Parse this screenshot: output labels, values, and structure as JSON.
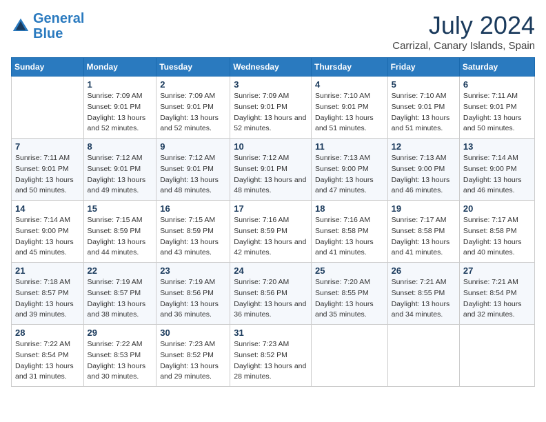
{
  "logo": {
    "text1": "General",
    "text2": "Blue"
  },
  "title": "July 2024",
  "location": "Carrizal, Canary Islands, Spain",
  "days_header": [
    "Sunday",
    "Monday",
    "Tuesday",
    "Wednesday",
    "Thursday",
    "Friday",
    "Saturday"
  ],
  "weeks": [
    {
      "cells": [
        {
          "day": null,
          "sunrise": null,
          "sunset": null,
          "daylight": null
        },
        {
          "day": "1",
          "sunrise": "Sunrise: 7:09 AM",
          "sunset": "Sunset: 9:01 PM",
          "daylight": "Daylight: 13 hours and 52 minutes."
        },
        {
          "day": "2",
          "sunrise": "Sunrise: 7:09 AM",
          "sunset": "Sunset: 9:01 PM",
          "daylight": "Daylight: 13 hours and 52 minutes."
        },
        {
          "day": "3",
          "sunrise": "Sunrise: 7:09 AM",
          "sunset": "Sunset: 9:01 PM",
          "daylight": "Daylight: 13 hours and 52 minutes."
        },
        {
          "day": "4",
          "sunrise": "Sunrise: 7:10 AM",
          "sunset": "Sunset: 9:01 PM",
          "daylight": "Daylight: 13 hours and 51 minutes."
        },
        {
          "day": "5",
          "sunrise": "Sunrise: 7:10 AM",
          "sunset": "Sunset: 9:01 PM",
          "daylight": "Daylight: 13 hours and 51 minutes."
        },
        {
          "day": "6",
          "sunrise": "Sunrise: 7:11 AM",
          "sunset": "Sunset: 9:01 PM",
          "daylight": "Daylight: 13 hours and 50 minutes."
        }
      ]
    },
    {
      "cells": [
        {
          "day": "7",
          "sunrise": "Sunrise: 7:11 AM",
          "sunset": "Sunset: 9:01 PM",
          "daylight": "Daylight: 13 hours and 50 minutes."
        },
        {
          "day": "8",
          "sunrise": "Sunrise: 7:12 AM",
          "sunset": "Sunset: 9:01 PM",
          "daylight": "Daylight: 13 hours and 49 minutes."
        },
        {
          "day": "9",
          "sunrise": "Sunrise: 7:12 AM",
          "sunset": "Sunset: 9:01 PM",
          "daylight": "Daylight: 13 hours and 48 minutes."
        },
        {
          "day": "10",
          "sunrise": "Sunrise: 7:12 AM",
          "sunset": "Sunset: 9:01 PM",
          "daylight": "Daylight: 13 hours and 48 minutes."
        },
        {
          "day": "11",
          "sunrise": "Sunrise: 7:13 AM",
          "sunset": "Sunset: 9:00 PM",
          "daylight": "Daylight: 13 hours and 47 minutes."
        },
        {
          "day": "12",
          "sunrise": "Sunrise: 7:13 AM",
          "sunset": "Sunset: 9:00 PM",
          "daylight": "Daylight: 13 hours and 46 minutes."
        },
        {
          "day": "13",
          "sunrise": "Sunrise: 7:14 AM",
          "sunset": "Sunset: 9:00 PM",
          "daylight": "Daylight: 13 hours and 46 minutes."
        }
      ]
    },
    {
      "cells": [
        {
          "day": "14",
          "sunrise": "Sunrise: 7:14 AM",
          "sunset": "Sunset: 9:00 PM",
          "daylight": "Daylight: 13 hours and 45 minutes."
        },
        {
          "day": "15",
          "sunrise": "Sunrise: 7:15 AM",
          "sunset": "Sunset: 8:59 PM",
          "daylight": "Daylight: 13 hours and 44 minutes."
        },
        {
          "day": "16",
          "sunrise": "Sunrise: 7:15 AM",
          "sunset": "Sunset: 8:59 PM",
          "daylight": "Daylight: 13 hours and 43 minutes."
        },
        {
          "day": "17",
          "sunrise": "Sunrise: 7:16 AM",
          "sunset": "Sunset: 8:59 PM",
          "daylight": "Daylight: 13 hours and 42 minutes."
        },
        {
          "day": "18",
          "sunrise": "Sunrise: 7:16 AM",
          "sunset": "Sunset: 8:58 PM",
          "daylight": "Daylight: 13 hours and 41 minutes."
        },
        {
          "day": "19",
          "sunrise": "Sunrise: 7:17 AM",
          "sunset": "Sunset: 8:58 PM",
          "daylight": "Daylight: 13 hours and 41 minutes."
        },
        {
          "day": "20",
          "sunrise": "Sunrise: 7:17 AM",
          "sunset": "Sunset: 8:58 PM",
          "daylight": "Daylight: 13 hours and 40 minutes."
        }
      ]
    },
    {
      "cells": [
        {
          "day": "21",
          "sunrise": "Sunrise: 7:18 AM",
          "sunset": "Sunset: 8:57 PM",
          "daylight": "Daylight: 13 hours and 39 minutes."
        },
        {
          "day": "22",
          "sunrise": "Sunrise: 7:19 AM",
          "sunset": "Sunset: 8:57 PM",
          "daylight": "Daylight: 13 hours and 38 minutes."
        },
        {
          "day": "23",
          "sunrise": "Sunrise: 7:19 AM",
          "sunset": "Sunset: 8:56 PM",
          "daylight": "Daylight: 13 hours and 36 minutes."
        },
        {
          "day": "24",
          "sunrise": "Sunrise: 7:20 AM",
          "sunset": "Sunset: 8:56 PM",
          "daylight": "Daylight: 13 hours and 36 minutes."
        },
        {
          "day": "25",
          "sunrise": "Sunrise: 7:20 AM",
          "sunset": "Sunset: 8:55 PM",
          "daylight": "Daylight: 13 hours and 35 minutes."
        },
        {
          "day": "26",
          "sunrise": "Sunrise: 7:21 AM",
          "sunset": "Sunset: 8:55 PM",
          "daylight": "Daylight: 13 hours and 34 minutes."
        },
        {
          "day": "27",
          "sunrise": "Sunrise: 7:21 AM",
          "sunset": "Sunset: 8:54 PM",
          "daylight": "Daylight: 13 hours and 32 minutes."
        }
      ]
    },
    {
      "cells": [
        {
          "day": "28",
          "sunrise": "Sunrise: 7:22 AM",
          "sunset": "Sunset: 8:54 PM",
          "daylight": "Daylight: 13 hours and 31 minutes."
        },
        {
          "day": "29",
          "sunrise": "Sunrise: 7:22 AM",
          "sunset": "Sunset: 8:53 PM",
          "daylight": "Daylight: 13 hours and 30 minutes."
        },
        {
          "day": "30",
          "sunrise": "Sunrise: 7:23 AM",
          "sunset": "Sunset: 8:52 PM",
          "daylight": "Daylight: 13 hours and 29 minutes."
        },
        {
          "day": "31",
          "sunrise": "Sunrise: 7:23 AM",
          "sunset": "Sunset: 8:52 PM",
          "daylight": "Daylight: 13 hours and 28 minutes."
        },
        {
          "day": null,
          "sunrise": null,
          "sunset": null,
          "daylight": null
        },
        {
          "day": null,
          "sunrise": null,
          "sunset": null,
          "daylight": null
        },
        {
          "day": null,
          "sunrise": null,
          "sunset": null,
          "daylight": null
        }
      ]
    }
  ]
}
